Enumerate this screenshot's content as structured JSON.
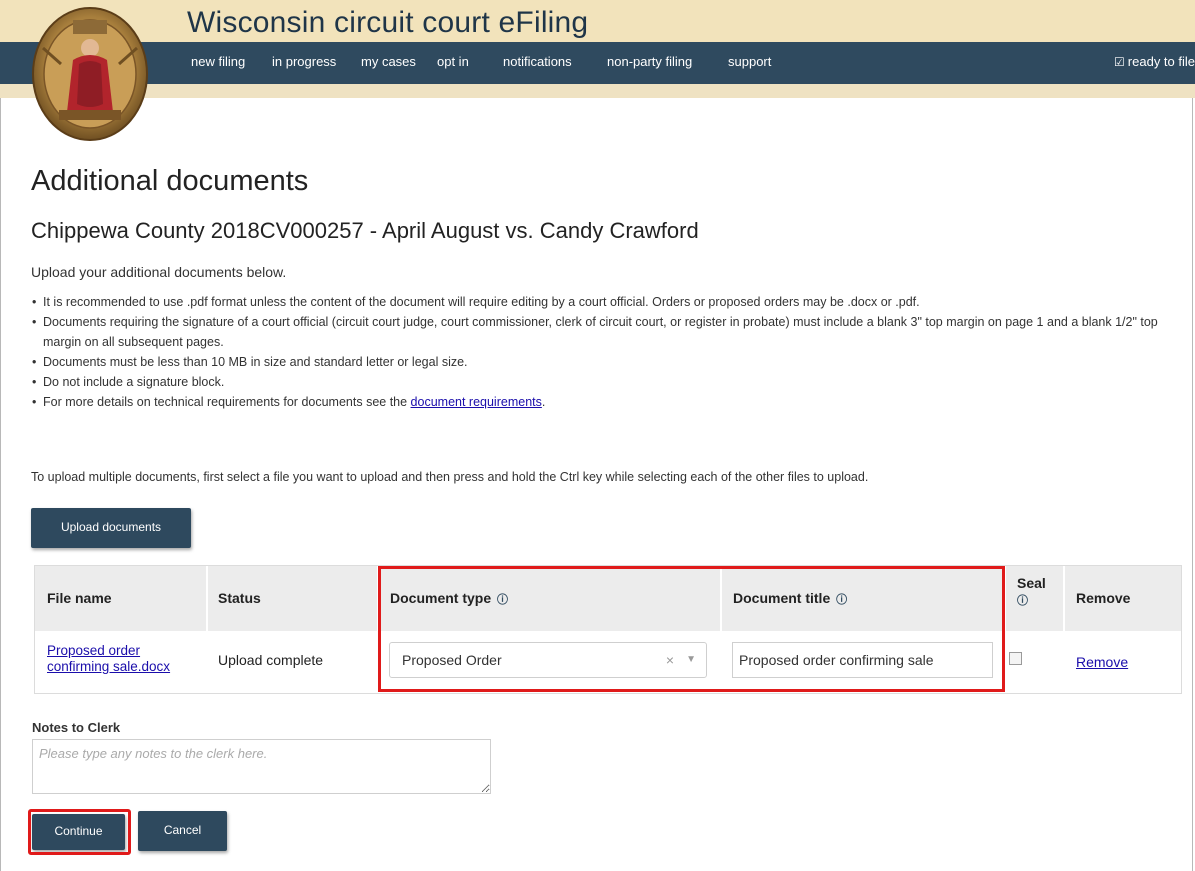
{
  "app": {
    "title": "Wisconsin circuit court eFiling"
  },
  "nav": {
    "items": [
      "new filing",
      "in progress",
      "my cases",
      "opt in",
      "notifications",
      "non-party filing",
      "support"
    ],
    "ready_label": "ready to file"
  },
  "page": {
    "heading": "Additional documents",
    "case_title": "Chippewa County 2018CV000257 - April August vs. Candy Crawford",
    "intro": "Upload your additional documents below.",
    "requirements": [
      "It is recommended to use .pdf format unless the content of the document will require editing by a court official. Orders or proposed orders may be .docx or .pdf.",
      "Documents requiring the signature of a court official (circuit court judge, court commissioner, clerk of circuit court, or register in probate) must include a blank 3\" top margin on page 1 and a blank 1/2\" top margin on all subsequent pages.",
      "Documents must be less than 10 MB in size and standard letter or legal size.",
      "Do not include a signature block."
    ],
    "requirements_last_prefix": "For more details on technical requirements for documents see the ",
    "requirements_link": "document requirements",
    "requirements_last_suffix": ".",
    "multi_upload_hint": "To upload multiple documents, first select a file you want to upload and then press and hold the Ctrl key while selecting each of the other files to upload.",
    "upload_button": "Upload documents"
  },
  "table": {
    "headers": {
      "file_name": "File name",
      "status": "Status",
      "document_type": "Document type",
      "document_title": "Document title",
      "seal": "Seal",
      "remove": "Remove"
    },
    "row": {
      "file_name_line1": "Proposed order",
      "file_name_line2": "confirming sale.docx",
      "status": "Upload complete",
      "document_type": "Proposed Order",
      "document_title": "Proposed order confirming sale",
      "seal_checked": false,
      "remove_label": "Remove"
    }
  },
  "notes": {
    "label": "Notes to Clerk",
    "placeholder": "Please type any notes to the clerk here."
  },
  "actions": {
    "continue": "Continue",
    "cancel": "Cancel"
  },
  "icons": {
    "info": "info-circle-icon",
    "ready": "check-square-icon",
    "clear": "times-icon",
    "caret": "caret-down-icon"
  },
  "colors": {
    "header_bg": "#f2e3bb",
    "nav_bg": "#2f4a5f",
    "button_bg": "#2e495e",
    "highlight": "#e01a1a"
  }
}
